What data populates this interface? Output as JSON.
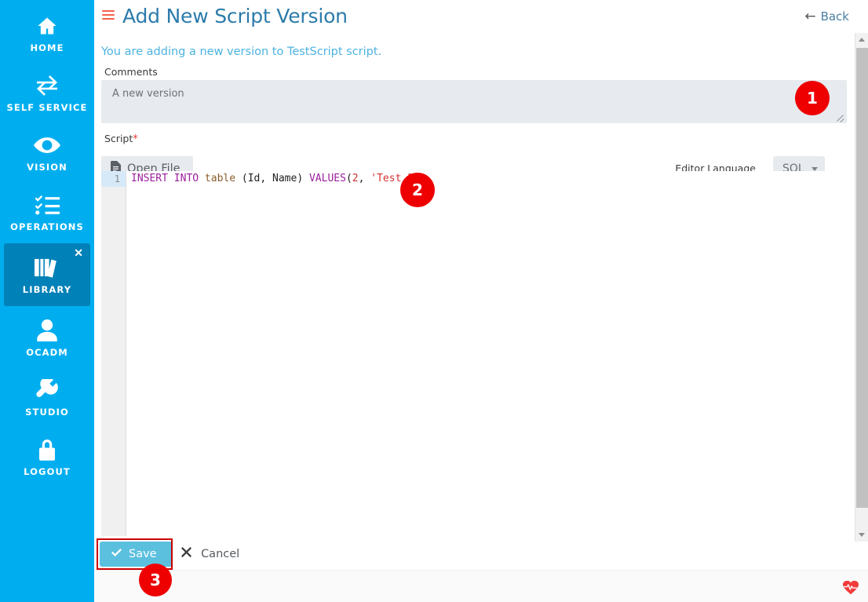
{
  "sidebar": {
    "items": [
      {
        "label": "HOME",
        "icon": "home-icon",
        "active": false,
        "closable": false
      },
      {
        "label": "SELF SERVICE",
        "icon": "exchange-icon",
        "active": false,
        "closable": false
      },
      {
        "label": "VISION",
        "icon": "eye-icon",
        "active": false,
        "closable": false
      },
      {
        "label": "OPERATIONS",
        "icon": "checklist-icon",
        "active": false,
        "closable": false
      },
      {
        "label": "LIBRARY",
        "icon": "books-icon",
        "active": true,
        "closable": true
      },
      {
        "label": "OCADM",
        "icon": "user-icon",
        "active": false,
        "closable": false
      },
      {
        "label": "STUDIO",
        "icon": "wrench-icon",
        "active": false,
        "closable": false
      },
      {
        "label": "LOGOUT",
        "icon": "lock-icon",
        "active": false,
        "closable": false
      }
    ],
    "close_glyph": "✕",
    "background_color": "#00aeef",
    "active_color": "#0081b8"
  },
  "header": {
    "menu_icon": "hamburger-icon",
    "menu_icon_color": "#f4604e",
    "title": "Add New Script Version",
    "title_color": "#2c7bab",
    "back_label": "Back",
    "back_arrow": "←"
  },
  "subtitle": {
    "text": "You are adding a new version to TestScript script.",
    "color": "#4cb3e0"
  },
  "form": {
    "comments": {
      "label": "Comments",
      "value": "A new version",
      "placeholder": "A new version",
      "resize_handle": "resize-grip"
    },
    "script": {
      "label": "Script",
      "required_marker": "*",
      "required_color": "#e8392f",
      "open_file_label": "Open File",
      "open_file_icon": "file-icon"
    },
    "editor_language": {
      "label": "Editor Language",
      "selected": "SQL",
      "options": [
        "SQL"
      ],
      "caret_icon": "chevron-down-icon"
    }
  },
  "editor": {
    "line_numbers": [
      "1"
    ],
    "active_line": 1,
    "code_tokens": [
      {
        "text": "INSERT INTO ",
        "type": "keyword"
      },
      {
        "text": "table",
        "type": "typename"
      },
      {
        "text": " (Id, Name) ",
        "type": "punctuation"
      },
      {
        "text": "VALUES",
        "type": "keyword"
      },
      {
        "text": "(",
        "type": "punctuation"
      },
      {
        "text": "2",
        "type": "number"
      },
      {
        "text": ", ",
        "type": "punctuation"
      },
      {
        "text": "'Test 2'",
        "type": "string"
      },
      {
        "text": ")",
        "type": "punctuation"
      }
    ],
    "plain_text": "INSERT INTO table (Id, Name) VALUES(2, 'Test 2')"
  },
  "footer": {
    "save_label": "Save",
    "save_icon": "check-icon",
    "save_color": "#5bc0de",
    "cancel_label": "Cancel",
    "cancel_icon": "x-icon",
    "status_icon": "heartbeat-icon",
    "status_icon_color": "#f23b3b"
  },
  "scrollbar": {
    "up_icon": "chevron-up-icon",
    "down_icon": "chevron-down-icon",
    "thumb": "scroll-thumb"
  },
  "annotations": [
    {
      "number": "1",
      "target": "comments-field"
    },
    {
      "number": "2",
      "target": "code-editor"
    },
    {
      "number": "3",
      "target": "save-button"
    }
  ]
}
